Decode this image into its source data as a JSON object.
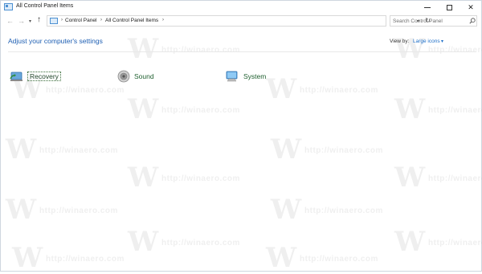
{
  "window": {
    "title": "All Control Panel Items"
  },
  "navigation": {
    "breadcrumbs": [
      "Control Panel",
      "All Control Panel Items"
    ]
  },
  "search": {
    "placeholder": "Search Control Panel"
  },
  "content": {
    "heading": "Adjust your computer's settings",
    "view_by_label": "View by:",
    "view_by_value": "Large icons",
    "items": [
      {
        "label": "Recovery",
        "icon": "recovery-icon"
      },
      {
        "label": "Sound",
        "icon": "speaker-icon"
      },
      {
        "label": "System",
        "icon": "computer-icon"
      }
    ]
  },
  "watermark": {
    "letter": "W",
    "text": "http://winaero.com"
  },
  "colors": {
    "accent": "#1e5fb3",
    "item_text": "#1e5f2e"
  }
}
